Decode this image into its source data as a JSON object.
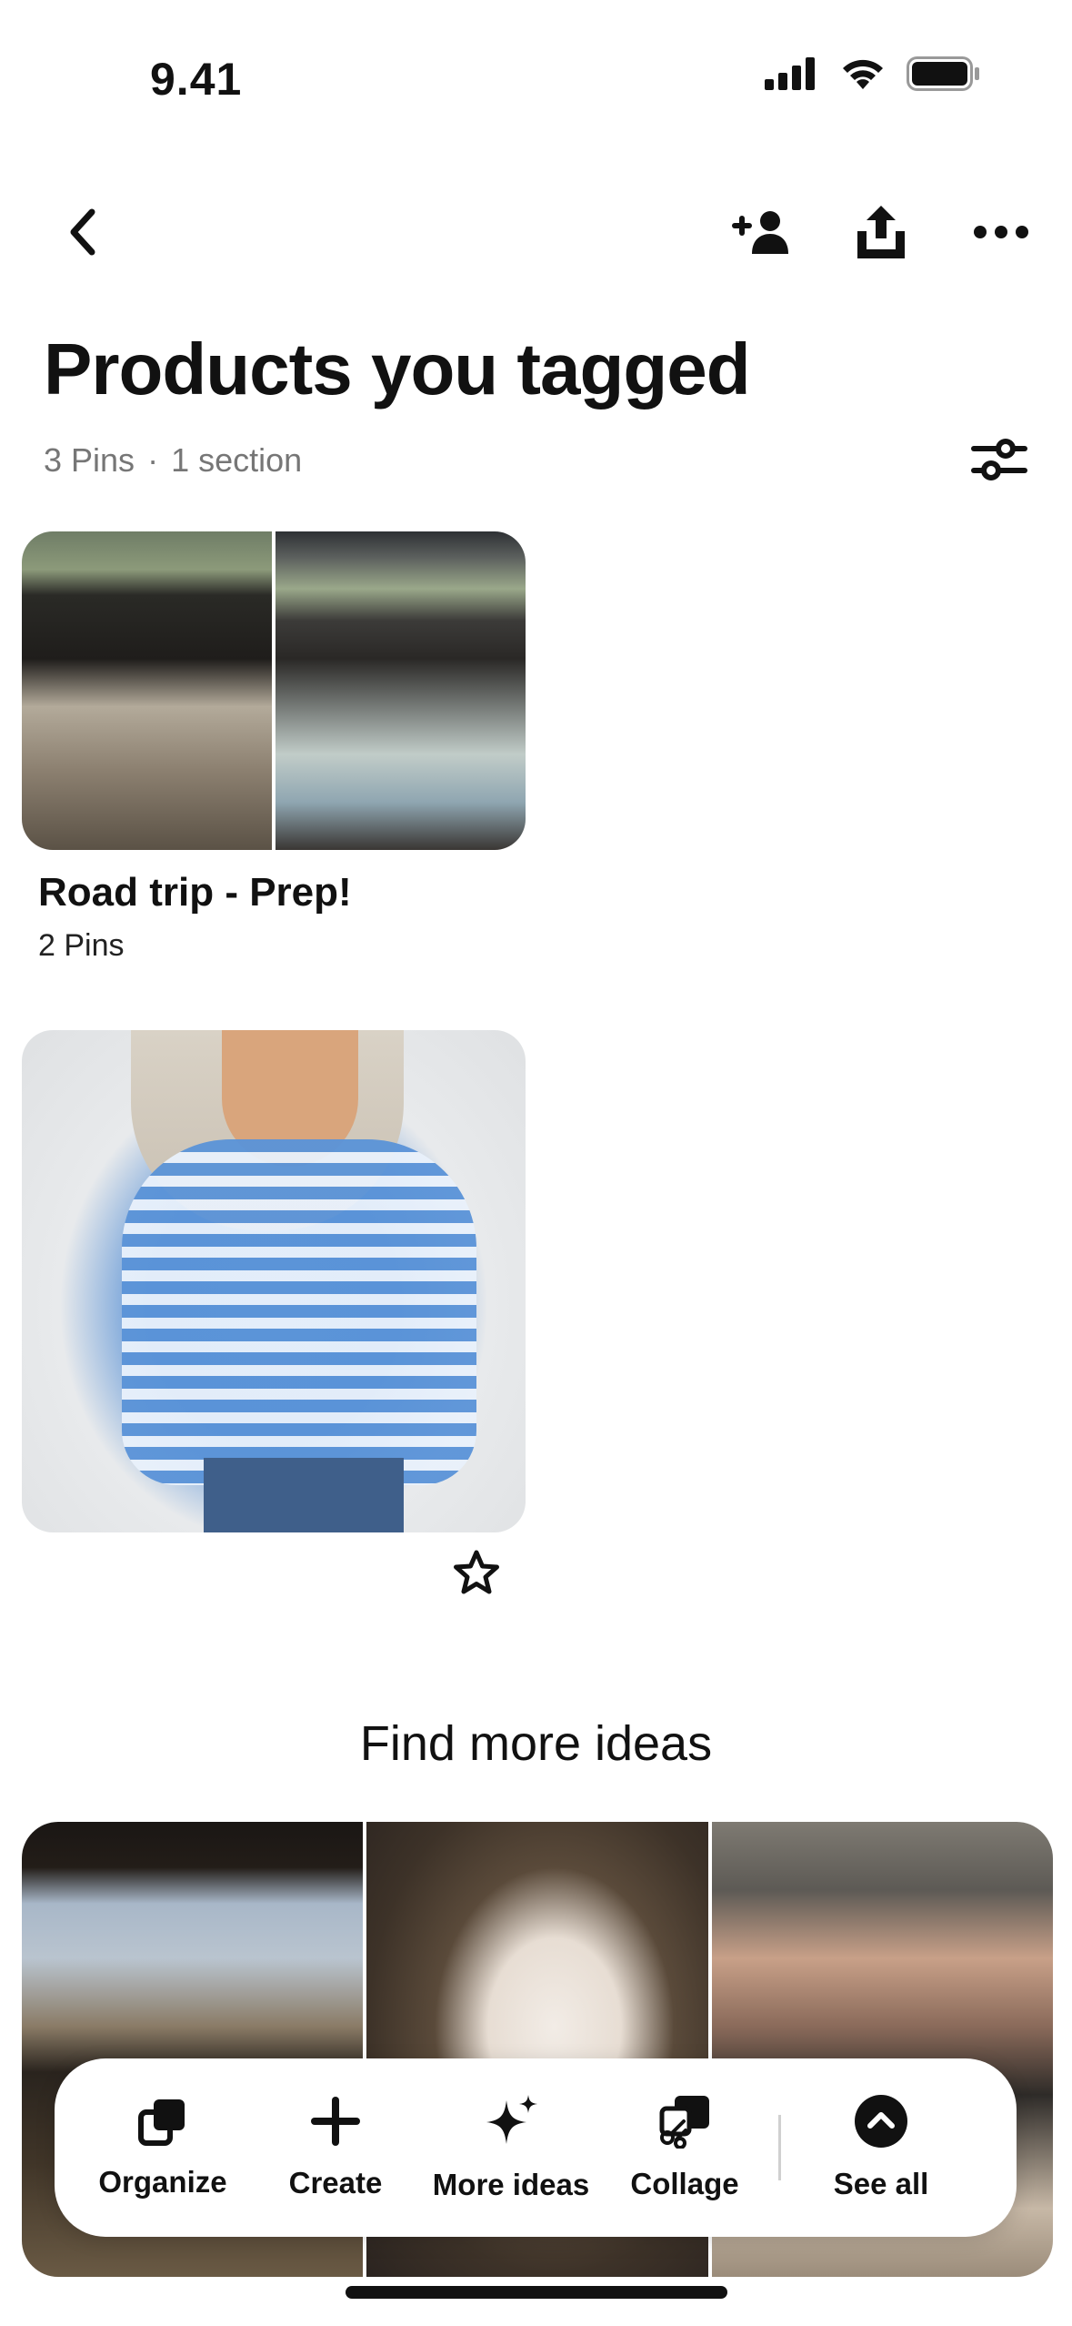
{
  "status_bar": {
    "time": "9.41"
  },
  "nav": {
    "back_icon": "chevron-left-icon",
    "add_collaborator_icon": "add-person-icon",
    "share_icon": "share-icon",
    "more_icon": "more-horizontal-icon"
  },
  "header": {
    "title": "Products you tagged",
    "pins_count": "3 Pins",
    "separator": "·",
    "sections_count": "1 section"
  },
  "section": {
    "name": "Road trip - Prep!",
    "count": "2 Pins"
  },
  "find_more": {
    "heading": "Find more ideas"
  },
  "actions": [
    {
      "label": "Organize",
      "icon": "organize-icon"
    },
    {
      "label": "Create",
      "icon": "plus-icon"
    },
    {
      "label": "More ideas",
      "icon": "sparkle-icon"
    },
    {
      "label": "Collage",
      "icon": "collage-icon"
    },
    {
      "label": "See all",
      "icon": "chevron-up-circle-icon"
    }
  ]
}
